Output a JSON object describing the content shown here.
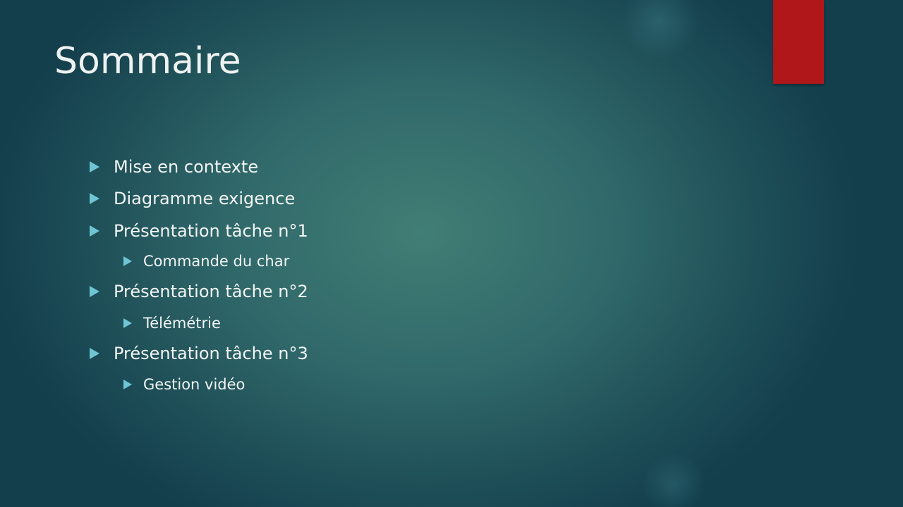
{
  "slide": {
    "title": "Sommaire",
    "accent_color": "#b0171a",
    "bullet_color": "#6fc5d3",
    "items": [
      {
        "level": 1,
        "label": "Mise en contexte"
      },
      {
        "level": 1,
        "label": "Diagramme exigence"
      },
      {
        "level": 1,
        "label": "Présentation tâche n°1"
      },
      {
        "level": 2,
        "label": "Commande du char"
      },
      {
        "level": 1,
        "label": "Présentation tâche n°2"
      },
      {
        "level": 2,
        "label": "Télémétrie"
      },
      {
        "level": 1,
        "label": "Présentation tâche n°3"
      },
      {
        "level": 2,
        "label": "Gestion vidéo"
      }
    ]
  }
}
